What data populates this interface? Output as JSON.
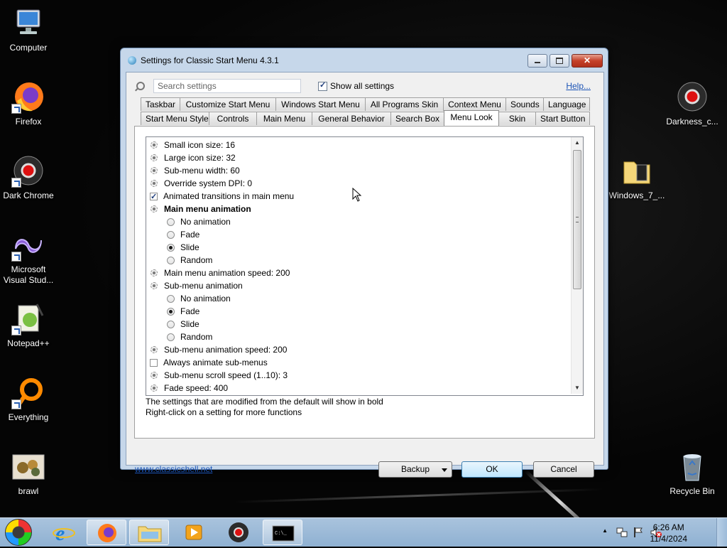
{
  "desktop": {
    "icons": [
      {
        "label": "Computer"
      },
      {
        "label": "Firefox"
      },
      {
        "label": "Dark Chrome"
      },
      {
        "label": "Microsoft Visual Stud..."
      },
      {
        "label": "Notepad++"
      },
      {
        "label": "Everything"
      },
      {
        "label": "brawl"
      },
      {
        "label": "Darkness_c..."
      },
      {
        "label": "Windows_7_..."
      },
      {
        "label": "Recycle Bin"
      }
    ]
  },
  "dialog": {
    "title": "Settings for Classic Start Menu 4.3.1",
    "close_glyph": "✕",
    "search_placeholder": "Search settings",
    "show_all_label": "Show all settings",
    "show_all_checked": true,
    "help_label": "Help...",
    "tabs_row1": [
      "Taskbar",
      "Customize Start Menu",
      "Windows Start Menu",
      "All Programs Skin",
      "Context Menu",
      "Sounds",
      "Language"
    ],
    "tabs_row2": [
      "Start Menu Style",
      "Controls",
      "Main Menu",
      "General Behavior",
      "Search Box",
      "Menu Look",
      "Skin",
      "Start Button"
    ],
    "active_tab": "Menu Look",
    "settings": [
      {
        "label": "Small icon size: 16",
        "kind": "gear"
      },
      {
        "label": "Large icon size: 32",
        "kind": "gear"
      },
      {
        "label": "Sub-menu width: 60",
        "kind": "gear"
      },
      {
        "label": "Override system DPI: 0",
        "kind": "gear"
      },
      {
        "label": "Animated transitions in main menu",
        "kind": "check",
        "checked": true
      },
      {
        "label": "Main menu animation",
        "kind": "gear",
        "bold": true
      },
      {
        "label": "No animation",
        "kind": "radio",
        "checked": false
      },
      {
        "label": "Fade",
        "kind": "radio",
        "checked": false
      },
      {
        "label": "Slide",
        "kind": "radio",
        "checked": true
      },
      {
        "label": "Random",
        "kind": "radio",
        "checked": false
      },
      {
        "label": "Main menu animation speed: 200",
        "kind": "gear"
      },
      {
        "label": "Sub-menu animation",
        "kind": "gear"
      },
      {
        "label": "No animation",
        "kind": "radio",
        "checked": false
      },
      {
        "label": "Fade",
        "kind": "radio",
        "checked": true
      },
      {
        "label": "Slide",
        "kind": "radio",
        "checked": false
      },
      {
        "label": "Random",
        "kind": "radio",
        "checked": false
      },
      {
        "label": "Sub-menu animation speed: 200",
        "kind": "gear"
      },
      {
        "label": "Always animate sub-menus",
        "kind": "check",
        "checked": false
      },
      {
        "label": "Sub-menu scroll speed (1..10): 3",
        "kind": "gear"
      },
      {
        "label": "Fade speed: 400",
        "kind": "gear"
      }
    ],
    "info_line1": "The settings that are modified from the default will show in bold",
    "info_line2": "Right-click on a setting for more functions",
    "website_link": "www.classicshell.net",
    "backup_label": "Backup",
    "ok_label": "OK",
    "cancel_label": "Cancel"
  },
  "taskbar": {
    "time": "6:26 AM",
    "date": "11/4/2024",
    "tray_arrow": "▲"
  }
}
